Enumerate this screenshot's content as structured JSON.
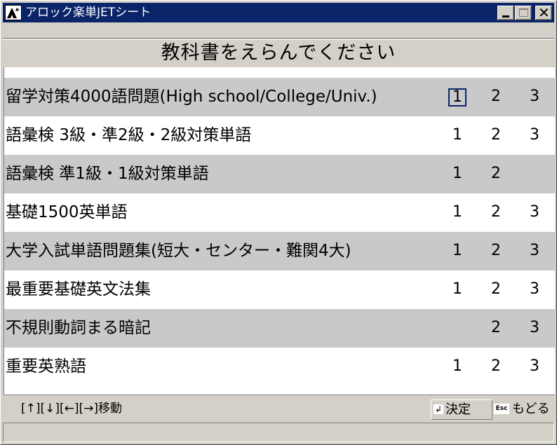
{
  "window": {
    "title": "アロック楽単JETシート",
    "minimize_glyph": "_",
    "close_glyph": "✕"
  },
  "heading": "教科書をえらんでください",
  "books": [
    {
      "title": "留学対策4000語問題(High school/College/Univ.)",
      "levels": [
        "1",
        "2",
        "3"
      ],
      "selected": "1"
    },
    {
      "title": "語彙検 3級・準2級・2級対策単語",
      "levels": [
        "1",
        "2",
        "3"
      ]
    },
    {
      "title": "語彙検 準1級・1級対策単語",
      "levels": [
        "1",
        "2",
        ""
      ]
    },
    {
      "title": "基礎1500英単語",
      "levels": [
        "1",
        "2",
        "3"
      ]
    },
    {
      "title": "大学入試単語問題集(短大・センター・難関4大)",
      "levels": [
        "1",
        "2",
        "3"
      ]
    },
    {
      "title": "最重要基礎英文法集",
      "levels": [
        "1",
        "2",
        "3"
      ]
    },
    {
      "title": "不規則動詞まる暗記",
      "levels": [
        "",
        "2",
        "3"
      ]
    },
    {
      "title": "重要英熟語",
      "levels": [
        "1",
        "2",
        "3"
      ]
    }
  ],
  "footer": {
    "hint": "[↑][↓][←][→]移動",
    "ok_icon": "↲",
    "ok_label": "決定",
    "back_icon": "Esc",
    "back_label": "もどる"
  },
  "colors": {
    "titlebar": "#0a246a",
    "row_shade": "#c9c9c9",
    "row_plain": "#ffffff",
    "face": "#d4d0c8"
  }
}
